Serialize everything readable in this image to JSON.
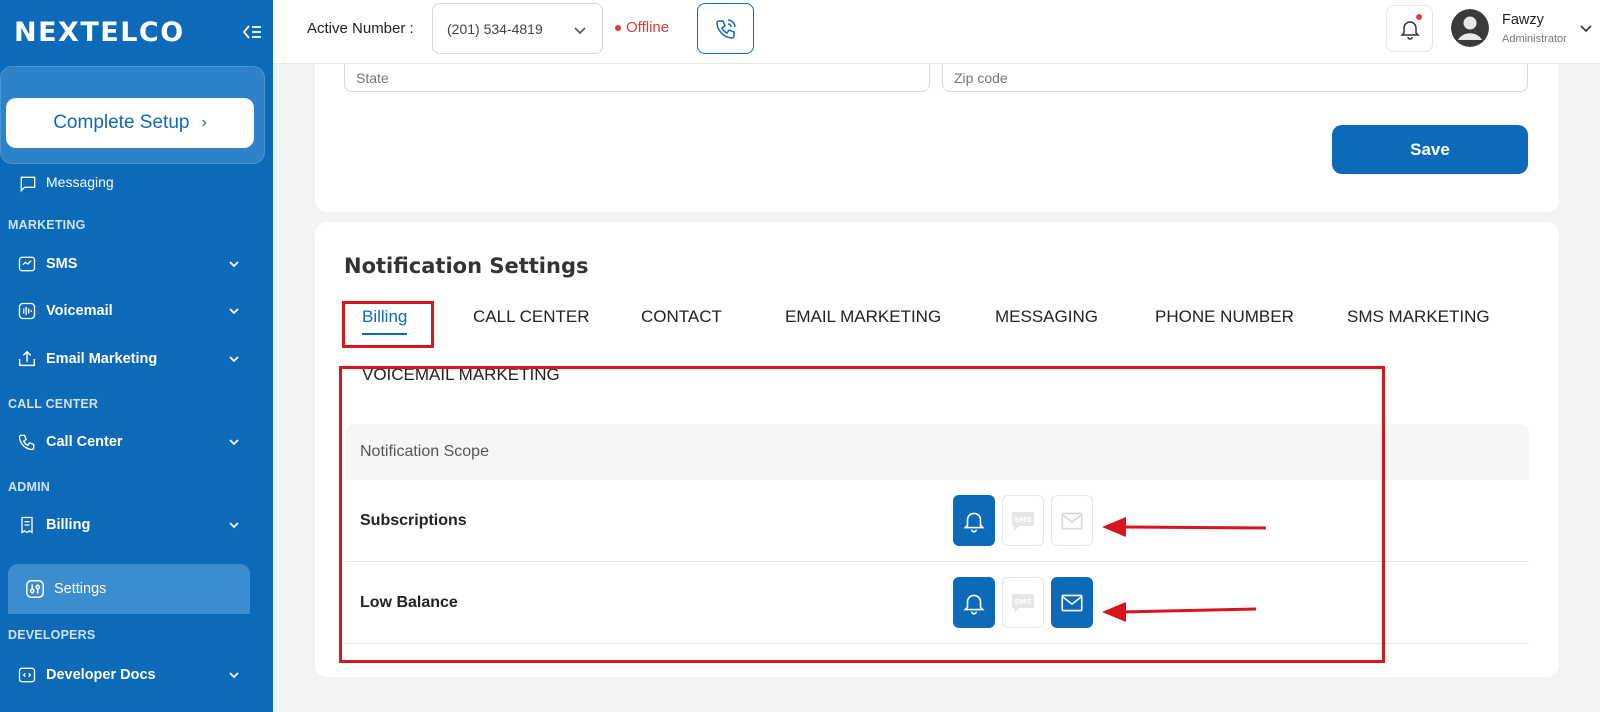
{
  "brand": {
    "logo": "NEXTELCO"
  },
  "sidebar": {
    "setup_label": "Complete Setup",
    "partial_item": "Messaging",
    "sections": {
      "marketing": "MARKETING",
      "call_center": "CALL CENTER",
      "admin": "ADMIN",
      "developers": "DEVELOPERS"
    },
    "items": {
      "sms": "SMS",
      "voicemail": "Voicemail",
      "email_marketing": "Email Marketing",
      "call_center": "Call Center",
      "billing": "Billing",
      "settings": "Settings",
      "developer_docs": "Developer Docs"
    }
  },
  "topbar": {
    "active_label": "Active Number :",
    "active_number": "(201) 534-4819",
    "status": "Offline",
    "user_name": "Fawzy",
    "user_role": "Administrator"
  },
  "address": {
    "state_placeholder": "State",
    "zip_placeholder": "Zip code",
    "save_label": "Save"
  },
  "notifications": {
    "title": "Notification Settings",
    "tabs": [
      "Billing",
      "CALL CENTER",
      "CONTACT",
      "EMAIL MARKETING",
      "MESSAGING",
      "PHONE NUMBER",
      "SMS MARKETING",
      "VOICEMAIL MARKETING"
    ],
    "active_tab": "Billing",
    "scope_header": "Notification Scope",
    "rows": [
      {
        "label": "Subscriptions",
        "in_app": true,
        "sms": false,
        "email": false
      },
      {
        "label": "Low Balance",
        "in_app": true,
        "sms": false,
        "email": true
      }
    ]
  },
  "colors": {
    "brand": "#0d6ab8",
    "annotation": "#d8141c",
    "status_offline": "#e03b3b"
  }
}
